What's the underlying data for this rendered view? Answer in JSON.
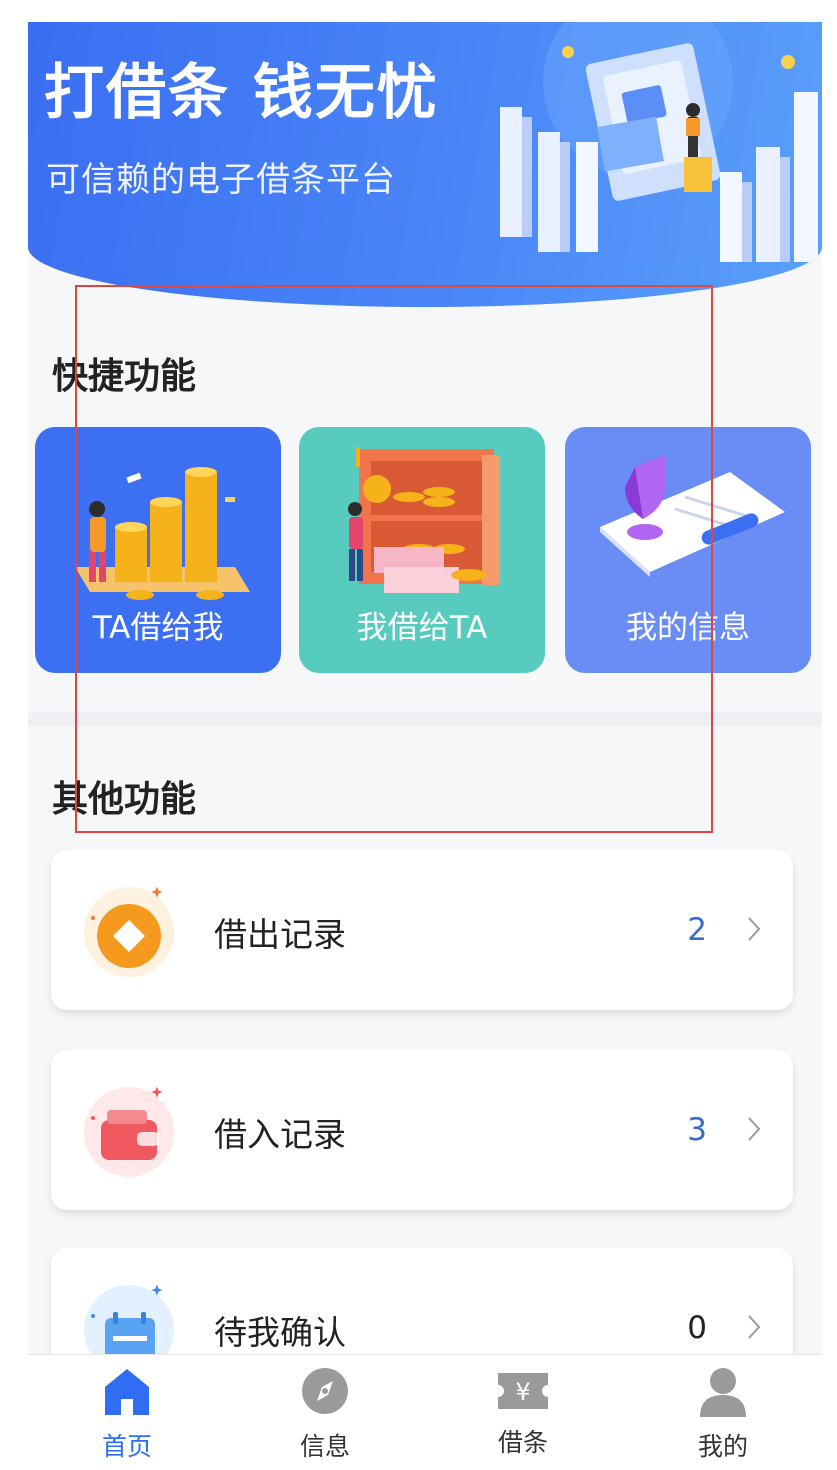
{
  "banner": {
    "title": "打借条  钱无忧",
    "subtitle": "可信赖的电子借条平台"
  },
  "quick": {
    "heading": "快捷功能",
    "tiles": [
      {
        "label": "TA借给我",
        "color": "#3d6ff2",
        "icon": "coin-stack-illustration"
      },
      {
        "label": "我借给TA",
        "color": "#58cbbf",
        "icon": "safe-illustration"
      },
      {
        "label": "我的信息",
        "color": "#6a8cf5",
        "icon": "id-card-illustration"
      }
    ]
  },
  "other": {
    "heading": "其他功能",
    "items": [
      {
        "label": "借出记录",
        "count": "2",
        "icon": "coin-icon"
      },
      {
        "label": "借入记录",
        "count": "3",
        "icon": "wallet-icon"
      },
      {
        "label": "待我确认",
        "count": "0",
        "icon": "calendar-icon"
      }
    ]
  },
  "nav": {
    "items": [
      {
        "label": "首页",
        "icon": "home-icon",
        "active": true
      },
      {
        "label": "信息",
        "icon": "compass-icon",
        "active": false
      },
      {
        "label": "借条",
        "icon": "ticket-icon",
        "active": false
      },
      {
        "label": "我的",
        "icon": "user-icon",
        "active": false
      }
    ]
  },
  "colors": {
    "accent": "#2f6df2",
    "highlight": "#e0463f",
    "count": "#3a6bc9"
  }
}
